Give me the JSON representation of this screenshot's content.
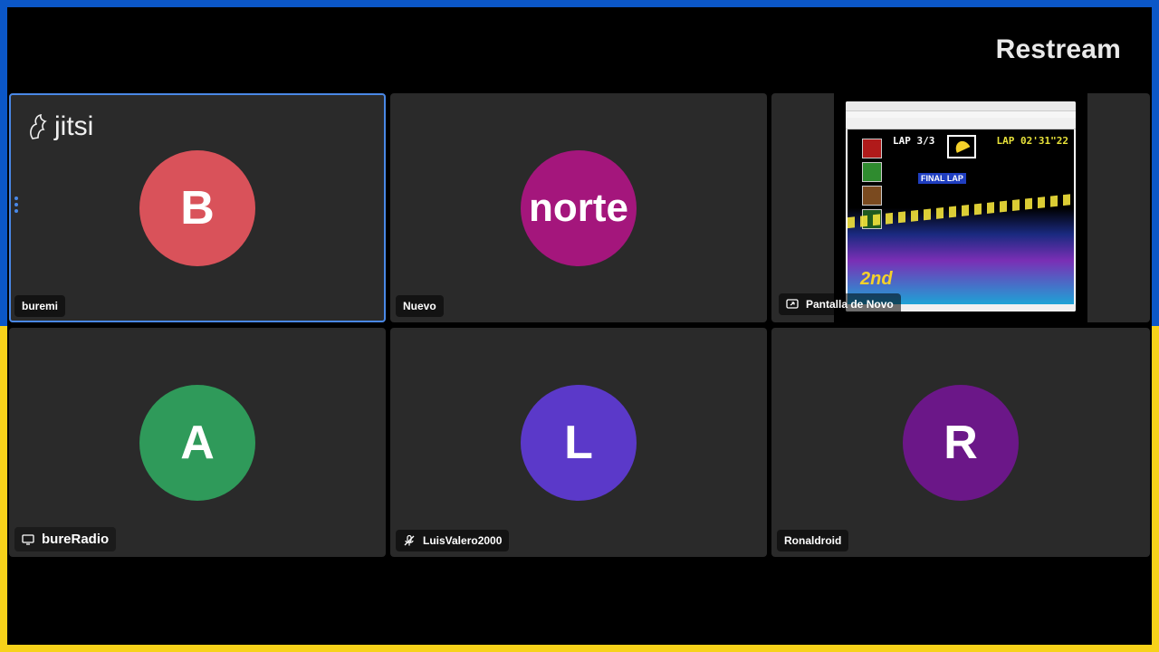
{
  "brand": "Restream",
  "logo": "jitsi",
  "tiles": [
    {
      "name": "buremi",
      "initial": "B",
      "color": "#d9525a",
      "active": true
    },
    {
      "name": "Nuevo",
      "initial": "norte",
      "color": "#a4167c",
      "active": false
    },
    {
      "name": "Pantalla de Novo",
      "initial": "",
      "color": "",
      "active": false
    },
    {
      "name": "bureRadio",
      "initial": "A",
      "color": "#2f9a5a",
      "active": false
    },
    {
      "name": "LuisValero2000",
      "initial": "L",
      "color": "#5b39c9",
      "active": false
    },
    {
      "name": "Ronaldroid",
      "initial": "R",
      "color": "#6b1788",
      "active": false
    }
  ],
  "game": {
    "lap": "LAP 3/3",
    "time": "LAP 02'31\"22",
    "final_lap": "FINAL LAP",
    "place": "2nd"
  },
  "icons": {
    "share": "screen-share-icon",
    "screen": "screen-icon",
    "mic_off": "mic-muted-icon",
    "menu": "vertical-dots-icon"
  }
}
